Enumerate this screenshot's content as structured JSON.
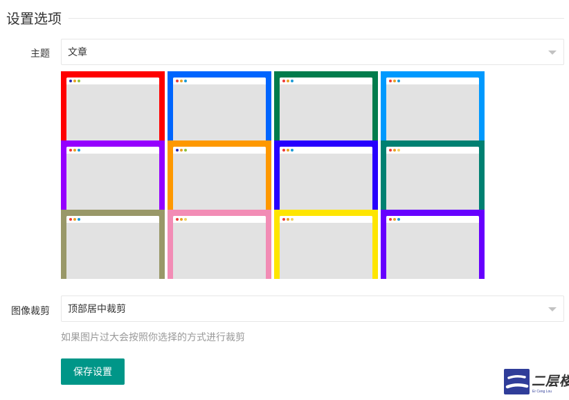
{
  "section": {
    "title": "设置选项"
  },
  "theme_field": {
    "label": "主题",
    "selected": "文章",
    "swatches": [
      {
        "color": "#fe0000",
        "dots": [
          "#2b2ab3",
          "#e8a224",
          "#90c13c"
        ]
      },
      {
        "color": "#0065fe",
        "dots": [
          "#ef3b36",
          "#e8a224",
          "#1a9ad6"
        ]
      },
      {
        "color": "#017c4c",
        "dots": [
          "#ef3b36",
          "#e8a224",
          "#1a9ad6"
        ]
      },
      {
        "color": "#0099fe",
        "dots": [
          "#ef3b36",
          "#e8a224",
          "#1a9ad6"
        ]
      },
      {
        "color": "#9500fe",
        "dots": [
          "#ef3b36",
          "#e8a224",
          "#1a9ad6"
        ]
      },
      {
        "color": "#fe9800",
        "dots": [
          "#2b2ab3",
          "#e8a224",
          "#90c13c"
        ]
      },
      {
        "color": "#2600fe",
        "dots": [
          "#ef3b36",
          "#e8a224",
          "#1a9ad6"
        ]
      },
      {
        "color": "#008071",
        "dots": [
          "#ef3b36",
          "#e8a224",
          "#f0d060"
        ]
      },
      {
        "color": "#999868",
        "dots": [
          "#ef3b36",
          "#e8a224",
          "#1a9ad6"
        ]
      },
      {
        "color": "#f28cb5",
        "dots": [
          "#ef3b36",
          "#e8a224",
          "#f0d060"
        ]
      },
      {
        "color": "#fee500",
        "dots": [
          "#ef3b36",
          "#e8a224",
          "#f0d060"
        ]
      },
      {
        "color": "#6600fe",
        "dots": [
          "#ef3b36",
          "#e8a224",
          "#1a9ad6"
        ]
      }
    ]
  },
  "crop_field": {
    "label": "图像裁剪",
    "selected": "顶部居中裁剪",
    "help": "如果图片过大会按照你选择的方式进行裁剪"
  },
  "save_button": {
    "label": "保存设置",
    "color": "#009688"
  },
  "watermark": {
    "text": "二层楼",
    "small": "Er Ceng Lou"
  }
}
